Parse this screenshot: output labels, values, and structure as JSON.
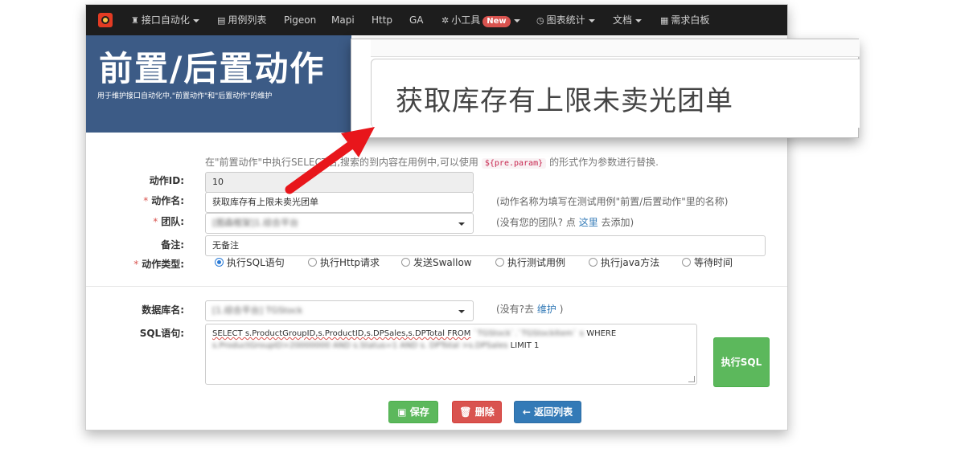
{
  "navbar": {
    "items": [
      {
        "label": "接口自动化",
        "icon": "castle-icon",
        "dropdown": true
      },
      {
        "label": "用例列表",
        "icon": "list-icon",
        "dropdown": false
      },
      {
        "label": "Pigeon",
        "icon": "",
        "dropdown": false
      },
      {
        "label": "Mapi",
        "icon": "",
        "dropdown": false
      },
      {
        "label": "Http",
        "icon": "",
        "dropdown": false
      },
      {
        "label": "GA",
        "icon": "",
        "dropdown": false
      },
      {
        "label": "小工具",
        "icon": "gear-icon",
        "dropdown": true,
        "badge": "New"
      },
      {
        "label": "图表统计",
        "icon": "clock-icon",
        "dropdown": true
      },
      {
        "label": "文档",
        "icon": "",
        "dropdown": true
      },
      {
        "label": "需求白板",
        "icon": "board-icon",
        "dropdown": false
      }
    ]
  },
  "banner": {
    "title": "前置/后置动作",
    "subtitle": "用于维护接口自动化中,\"前置动作\"和\"后置动作\"的维护"
  },
  "info": {
    "before": "在\"前置动作\"中执行SELECT",
    "after": "后,搜索的到内容在用例中,可以使用",
    "code": "${pre.param}",
    "tail": "的形式作为参数进行替换."
  },
  "form": {
    "id_label": "动作ID:",
    "id_value": "10",
    "name_label": "动作名:",
    "name_value": "获取库存有上限未卖光团单",
    "name_hint": "(动作名称为填写在测试用例\"前置/后置动作\"里的名称)",
    "team_label": "团队:",
    "team_value": "[图森框架]1.综合平台",
    "team_hint_prefix": "(没有您的团队? 点",
    "team_hint_link": "这里",
    "team_hint_suffix": "去添加)",
    "remark_label": "备注:",
    "remark_value": "无备注",
    "type_label": "动作类型:",
    "type_options": [
      "执行SQL语句",
      "执行Http请求",
      "发送Swallow",
      "执行测试用例",
      "执行java方法",
      "等待时间"
    ],
    "type_selected": "执行SQL语句",
    "db_label": "数据库名:",
    "db_value": "[1.综合平台] TGStock",
    "db_hint_prefix": "(没有?去",
    "db_hint_link": "维护",
    "db_hint_suffix": ")",
    "sql_label": "SQL语句:",
    "sql_line1_a": "SELECT s.ProductGroupID,s.ProductID,s.DPSales,s.DPTotal FROM",
    "sql_line1_blur": "`TGStock`.`TGStockItem` s",
    "sql_line1_b": "WHERE",
    "sql_line2_blur": "s.ProductGroupID>20000000 AND s.Status=1 AND s. DPTotal >s.DPSales",
    "sql_line2_b": "LIMIT 1",
    "exec_sql_label": "执行SQL"
  },
  "actions": {
    "save_label": "保存",
    "delete_label": "删除",
    "back_label": "返回列表"
  },
  "zoom": {
    "text": "获取库存有上限未卖光团单"
  },
  "colors": {
    "navbar_bg": "#1d1d1d",
    "banner_bg": "#3c5b86",
    "arrow": "#e8161b",
    "success": "#5cb85c",
    "danger": "#d9534f",
    "primary": "#337ab7"
  }
}
